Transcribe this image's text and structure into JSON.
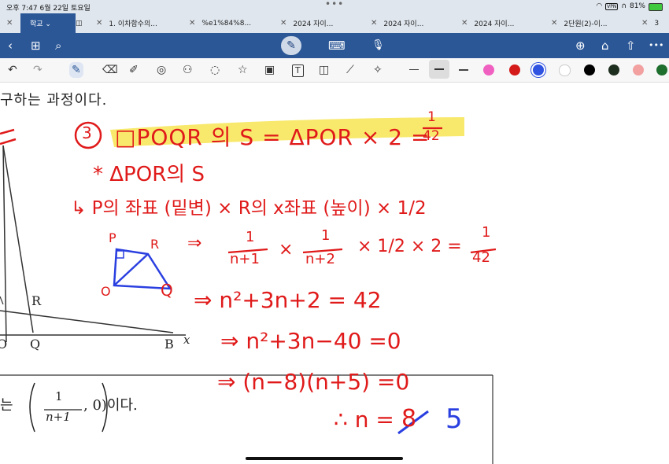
{
  "status": {
    "time_date": "오후 7:47  6월 22일 토요일",
    "dots": "•••",
    "vpn": "VPN",
    "battery": "81%"
  },
  "tabs": [
    {
      "label": "학교 ⌄"
    },
    {
      "label": "1. 이차함수의..."
    },
    {
      "label": "%e1%84%8..."
    },
    {
      "label": "2024 자이..."
    },
    {
      "label": "2024 자이..."
    },
    {
      "label": "2024 자이..."
    },
    {
      "label": "2024 자이..."
    },
    {
      "label": "2단원(2)-이..."
    },
    {
      "label": "3"
    }
  ],
  "toolbar": {
    "back": "‹",
    "grid": "⊞",
    "search": "⌕",
    "pen": "✎",
    "keyboard": "⌨",
    "mic": "🎙",
    "add_page": "⊕",
    "bookmark": "⌂",
    "share": "⇧",
    "more": "•••"
  },
  "tools": {
    "undo": "↶",
    "redo": "↷",
    "pen": "✎",
    "eraser": "⌫",
    "highlighter": "✐",
    "shape": "◎",
    "element": "⚇",
    "lasso": "◌",
    "sticker": "☆",
    "image": "▣",
    "text": "T",
    "camera": "◫",
    "ruler": "⟋",
    "laser": "✧"
  },
  "colors": [
    "#f060c0",
    "#d51a1a",
    "#3052e0",
    "#ffffff",
    "#000000",
    "#1e2e1e",
    "#f2a0a0",
    "#1e6e2e"
  ],
  "printed": {
    "top_text": "구하는 과정이다.",
    "label_R": "R",
    "label_O": "O",
    "label_Q": "Q",
    "label_B": "B",
    "label_x": "x",
    "bottom_prefix": "는",
    "frac_num": "1",
    "frac_den": "n+1",
    "bottom_suffix": ", 0)이다."
  },
  "notes": {
    "line1_circle": "3",
    "line1": "□POQR 의 S = ΔPOR × 2 =",
    "line1_frac_num": "1",
    "line1_frac_den": "42",
    "line2": "* ΔPOR의 S",
    "line3": "↳ P의 좌표 (밑변) × R의 x좌표 (높이) × 1/2",
    "diag_P": "P",
    "diag_R": "R",
    "diag_O": "O",
    "diag_Q": "Q",
    "line4_arrow": "⇒",
    "line4_f1n": "1",
    "line4_f1d": "n+1",
    "line4_times": "×",
    "line4_f2n": "1",
    "line4_f2d": "n+2",
    "line4_f3": "× 1/2 × 2 =",
    "line4_f4n": "1",
    "line4_f4d": "42",
    "line5": "⇒  n²+3n+2 = 42",
    "line6": "⇒ n²+3n−40 =0",
    "line7": "⇒  (n−8)(n+5) =0",
    "line8": "∴ n =",
    "line8_crossed": "8",
    "line8_answer": "5"
  }
}
